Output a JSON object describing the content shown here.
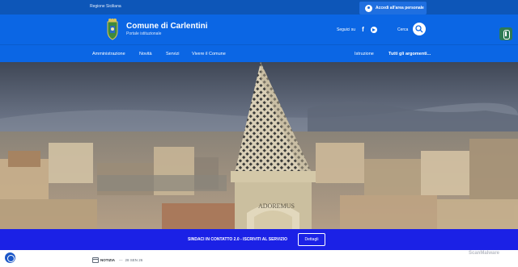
{
  "topbar": {
    "region": "Regione Siciliana",
    "login_label": "Accedi all'area personale"
  },
  "header": {
    "title": "Comune di Carlentini",
    "subtitle": "Portale istituzionale",
    "follow_label": "Seguici su",
    "search_label": "Cerca"
  },
  "nav": {
    "left": [
      "Amministrazione",
      "Novità",
      "Servizi",
      "Vivere il Comune"
    ],
    "right": [
      "Istruzione",
      "Tutti gli argomenti..."
    ]
  },
  "hero": {
    "belfry_inscription": "ADOREMUS"
  },
  "banner": {
    "text": "SINDACI IN CONTATTO 2.0 - ISCRIVITI AL SERVIZIO",
    "button": "Dettagli"
  },
  "news": {
    "type": "NOTIZIA",
    "separator": "—",
    "date": "28 SEN 26"
  },
  "watermark": "ScanMalware",
  "colors": {
    "topbar": "#0d56b8",
    "header": "#0b66e4",
    "banner": "#1b21e6",
    "accessibility": "#2d7a54"
  },
  "icons": [
    "user-icon",
    "facebook-icon",
    "telegram-icon",
    "search-icon",
    "accessibility-icon",
    "cookie-icon",
    "calendar-icon",
    "crest-icon"
  ]
}
